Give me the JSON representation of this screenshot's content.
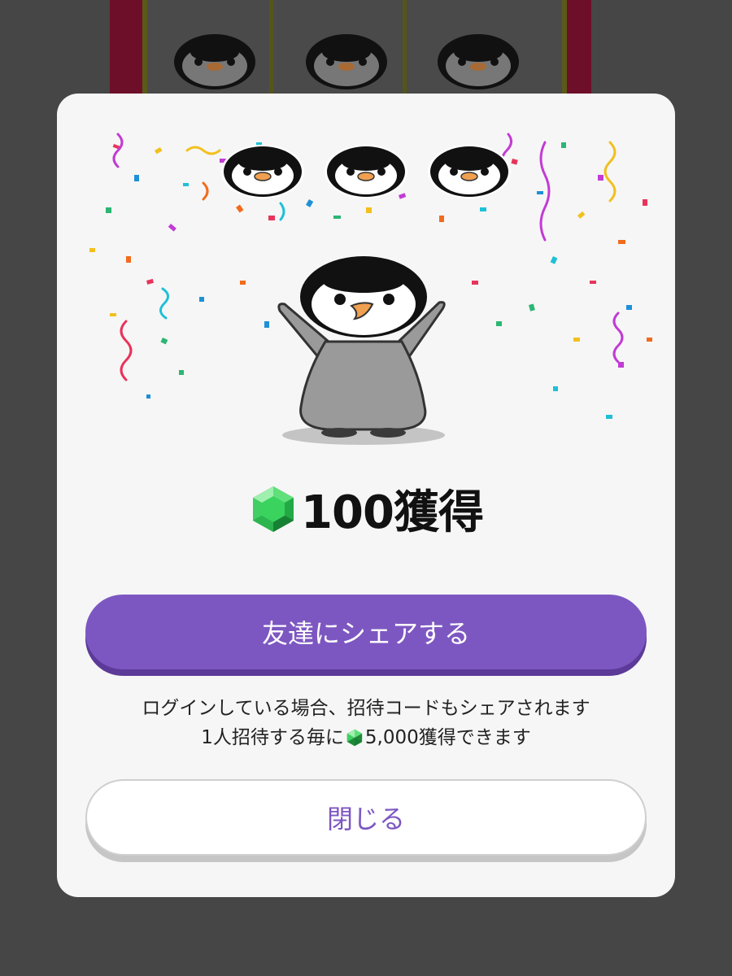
{
  "modal": {
    "reward_text": "100獲得",
    "share_button": "友達にシェアする",
    "note_line1": "ログインしている場合、招待コードもシェアされます",
    "note_line2_pre": "1人招待する毎に",
    "note_line2_post": "5,000獲得できます",
    "close_button": "閉じる"
  },
  "colors": {
    "accent": "#7d57c1",
    "overlay": "#464646",
    "gem": "#2ecc55"
  },
  "icons": [
    "penguin-icon",
    "gem-icon",
    "confetti"
  ]
}
